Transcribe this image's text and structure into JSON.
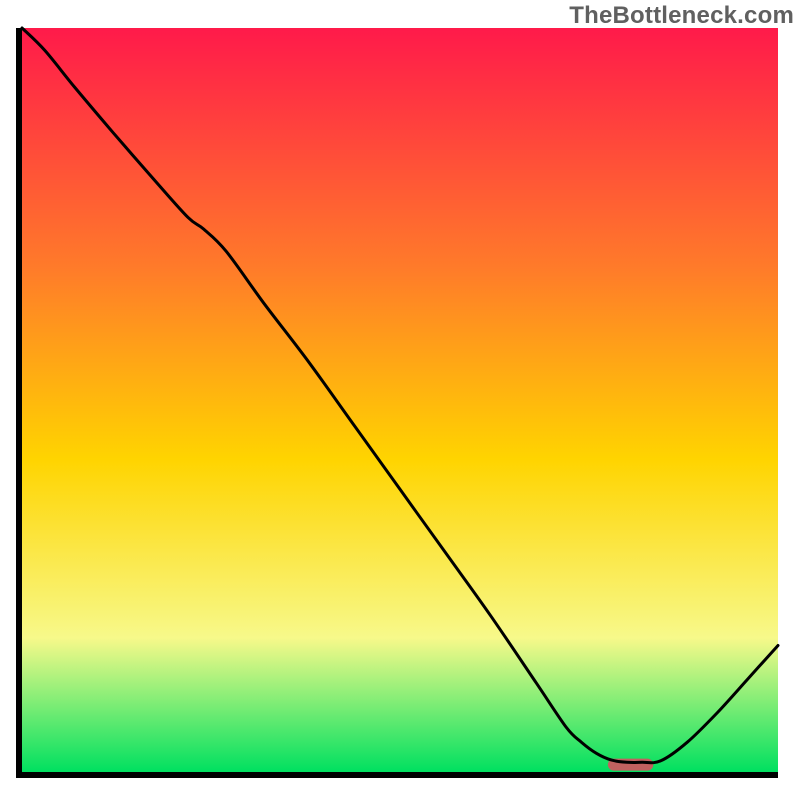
{
  "watermark": "TheBottleneck.com",
  "chart_data": {
    "type": "line",
    "title": "",
    "xlabel": "",
    "ylabel": "",
    "xlim": [
      0,
      100
    ],
    "ylim": [
      0,
      100
    ],
    "grid": false,
    "legend": false,
    "annotations": [],
    "series": [
      {
        "name": "curve",
        "color": "#000000",
        "x": [
          0.0,
          3.0,
          7.0,
          12.0,
          18.0,
          22.0,
          24.0,
          27.0,
          32.0,
          38.0,
          44.0,
          50.0,
          56.0,
          62.0,
          68.0,
          72.0,
          74.0,
          76.0,
          78.0,
          80.0,
          82.0,
          84.5,
          88.0,
          92.0,
          96.0,
          100.0
        ],
        "y": [
          100.0,
          97.0,
          92.0,
          86.0,
          79.0,
          74.5,
          73.0,
          70.0,
          63.0,
          55.0,
          46.5,
          38.0,
          29.5,
          21.0,
          12.0,
          6.0,
          4.0,
          2.5,
          1.6,
          1.3,
          1.3,
          1.5,
          4.0,
          8.0,
          12.5,
          17.0
        ]
      }
    ],
    "marker": {
      "name": "optimal-marker",
      "color": "#c1615f",
      "x": 80.5,
      "width_pct": 6.0,
      "y": 1.0
    },
    "colors": {
      "gradient_top": "#ff1a4a",
      "gradient_upper_mid": "#ff7a2a",
      "gradient_mid": "#ffd400",
      "gradient_lower_mid": "#f7f98a",
      "gradient_bottom": "#00e060",
      "axis": "#000000"
    }
  }
}
